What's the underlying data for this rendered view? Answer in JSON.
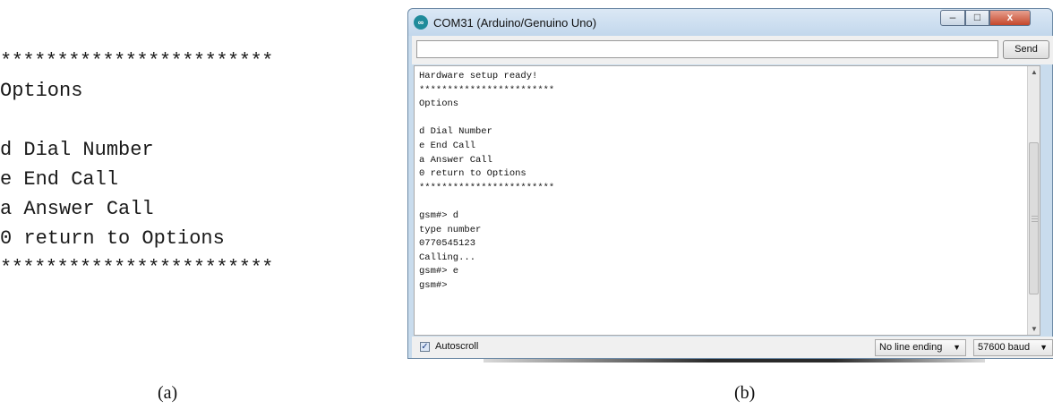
{
  "panel_a": {
    "lines": [
      "************************",
      "Options",
      "",
      "d Dial Number",
      "e End Call",
      "a Answer Call",
      "0 return to Options",
      "************************"
    ]
  },
  "window": {
    "title": "COM31 (Arduino/Genuino Uno)",
    "controls": {
      "minimize": "–",
      "maximize": "□",
      "close": "x"
    },
    "send_input_value": "",
    "send_label": "Send",
    "output_lines": [
      "Hardware setup ready!",
      "************************",
      "Options",
      "",
      "d Dial Number",
      "e End Call",
      "a Answer Call",
      "0 return to Options",
      "************************",
      "",
      "gsm#> d",
      "type number",
      "0770545123",
      "Calling...",
      "gsm#> e",
      "gsm#>"
    ],
    "autoscroll_label": "Autoscroll",
    "autoscroll_checked": "✓",
    "line_ending": "No line ending",
    "baud_rate": "57600 baud",
    "dropdown_arrow": "▼"
  },
  "captions": {
    "a": "(a)",
    "b": "(b)"
  },
  "icons": {
    "app": "arduino-icon",
    "scroll_up": "▲",
    "scroll_down": "▼"
  },
  "colors": {
    "title_bar": "#c9dced",
    "close_button": "#c5472b",
    "app_icon": "#1f8b9b"
  }
}
